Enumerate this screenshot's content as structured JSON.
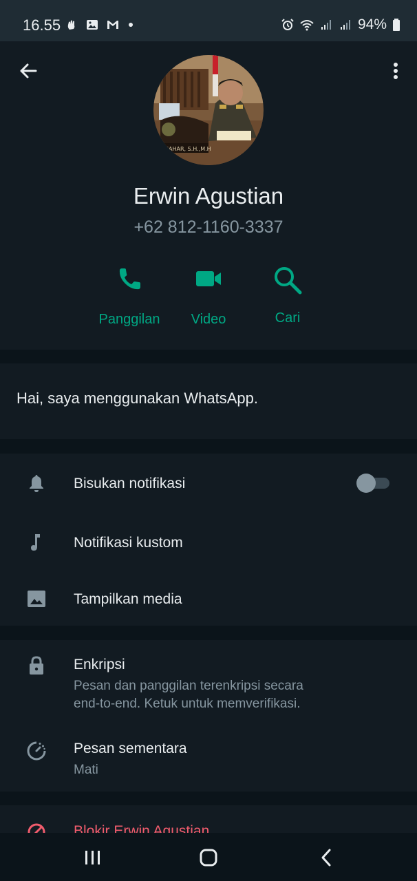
{
  "status_bar": {
    "time": "16.55",
    "battery": "94%",
    "left_icons": [
      "hand-icon",
      "image-icon",
      "gmail-icon",
      "dot-icon"
    ],
    "right_icons": [
      "alarm-icon",
      "wifi-icon",
      "signal-icon",
      "signal-icon",
      "battery-icon"
    ]
  },
  "header": {
    "back_icon": "arrow-left-icon",
    "more_icon": "more-vertical-icon",
    "avatar_caption": "HAHAR, S.H.,M.H",
    "name": "Erwin Agustian",
    "phone": "+62 812-1160-3337",
    "actions": [
      {
        "label": "Panggilan",
        "icon": "phone-icon"
      },
      {
        "label": "Video",
        "icon": "video-icon"
      },
      {
        "label": "Cari",
        "icon": "search-icon"
      }
    ],
    "accent_color": "#00a884"
  },
  "about": {
    "text": "Hai, saya menggunakan WhatsApp."
  },
  "settings": {
    "mute": {
      "label": "Bisukan notifikasi",
      "icon": "bell-icon",
      "enabled": false
    },
    "custom_notif": {
      "label": "Notifikasi kustom",
      "icon": "music-note-icon"
    },
    "media": {
      "label": "Tampilkan media",
      "icon": "image-icon"
    }
  },
  "security": {
    "encryption": {
      "label": "Enkripsi",
      "line1": "Pesan dan panggilan terenkripsi secara",
      "line2": "end-to-end. Ketuk untuk memverifikasi.",
      "icon": "lock-icon"
    },
    "disappearing": {
      "label": "Pesan sementara",
      "value": "Mati",
      "icon": "timer-icon"
    }
  },
  "block": {
    "label": "Blokir Erwin Agustian",
    "icon": "block-icon",
    "color": "#f15c6d"
  },
  "nav_bar": {
    "icons": [
      "recents-icon",
      "home-icon",
      "back-icon"
    ]
  }
}
